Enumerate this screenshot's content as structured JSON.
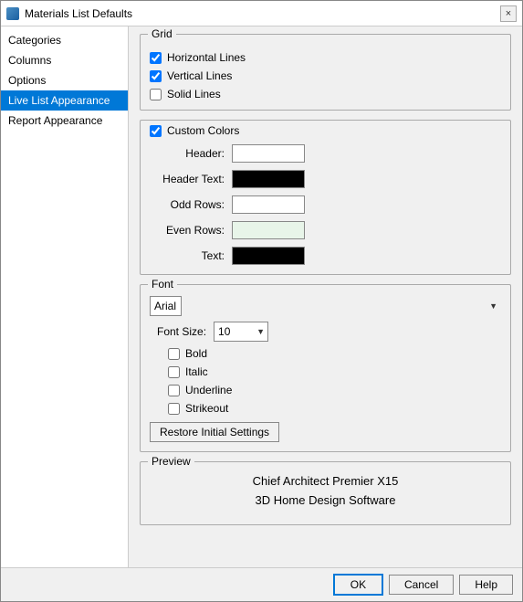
{
  "window": {
    "title": "Materials List Defaults",
    "close_label": "×"
  },
  "sidebar": {
    "items": [
      {
        "label": "Categories",
        "active": false
      },
      {
        "label": "Columns",
        "active": false
      },
      {
        "label": "Options",
        "active": false
      },
      {
        "label": "Live List Appearance",
        "active": true
      },
      {
        "label": "Report Appearance",
        "active": false
      }
    ]
  },
  "grid": {
    "title": "Grid",
    "horizontal_lines": {
      "label": "Horizontal Lines",
      "checked": true
    },
    "vertical_lines": {
      "label": "Vertical Lines",
      "checked": true
    },
    "solid_lines": {
      "label": "Solid Lines",
      "checked": false
    }
  },
  "custom_colors": {
    "title": "Custom Colors",
    "enabled": true,
    "rows": [
      {
        "label": "Header:",
        "color": "white"
      },
      {
        "label": "Header Text:",
        "color": "black"
      },
      {
        "label": "Odd Rows:",
        "color": "white"
      },
      {
        "label": "Even Rows:",
        "color": "light-green"
      },
      {
        "label": "Text:",
        "color": "black"
      }
    ]
  },
  "font": {
    "title": "Font",
    "font_name": "Arial",
    "font_size_label": "Font Size:",
    "font_size_value": "10",
    "bold_label": "Bold",
    "italic_label": "Italic",
    "underline_label": "Underline",
    "strikeout_label": "Strikeout",
    "bold_checked": false,
    "italic_checked": false,
    "underline_checked": false,
    "strikeout_checked": false
  },
  "restore_button": {
    "label": "Restore Initial Settings"
  },
  "preview": {
    "title": "Preview",
    "line1": "Chief Architect Premier X15",
    "line2": "3D Home Design Software"
  },
  "footer": {
    "ok_label": "OK",
    "cancel_label": "Cancel",
    "help_label": "Help"
  }
}
